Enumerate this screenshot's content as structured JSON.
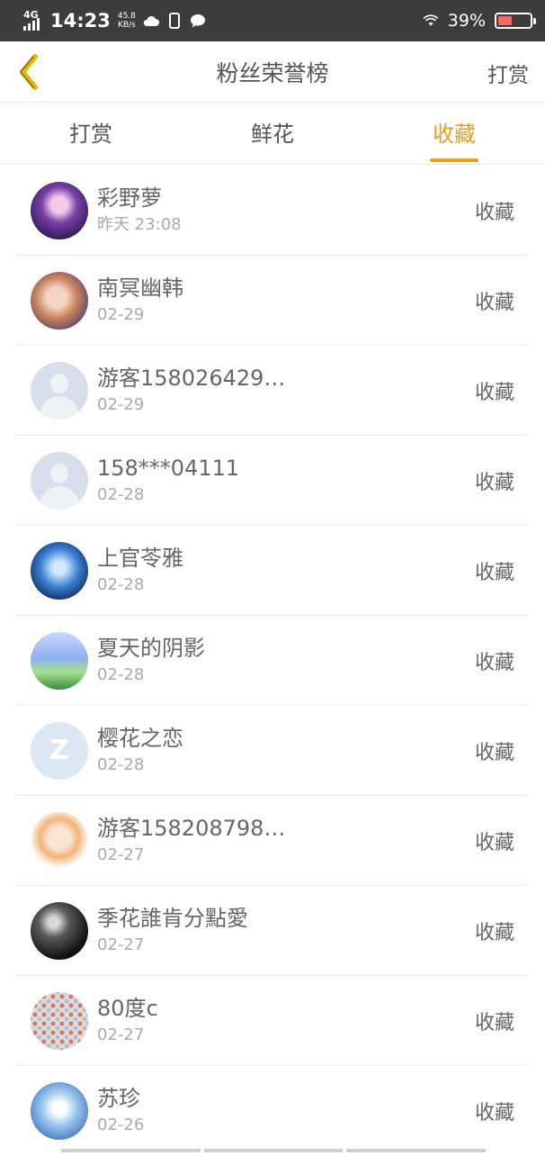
{
  "status_bar": {
    "network": "4G",
    "time": "14:23",
    "speed_value": "45.8",
    "speed_unit": "KB/s",
    "battery_pct": "39%",
    "battery_level": 0.39,
    "battery_color": "#f06a6a",
    "icons": [
      "cloud-icon",
      "phone-icon",
      "chat-bubble-icon",
      "wifi-icon",
      "battery-icon"
    ]
  },
  "header": {
    "title": "粉丝荣誉榜",
    "action": "打赏",
    "back_icon": "chevron-left-icon",
    "back_color": "#e6b800"
  },
  "tabs": [
    {
      "label": "打赏",
      "active": false
    },
    {
      "label": "鲜花",
      "active": false
    },
    {
      "label": "收藏",
      "active": true
    }
  ],
  "accent_color": "#e6a11c",
  "fans": [
    {
      "name": "彩野萝",
      "time": "昨天 23:08",
      "action": "收藏",
      "avatar": "anime-avatar"
    },
    {
      "name": "南冥幽韩",
      "time": "02-29",
      "action": "收藏",
      "avatar": "anime-avatar"
    },
    {
      "name": "游客158026429…",
      "time": "02-29",
      "action": "收藏",
      "avatar": "default-user-avatar"
    },
    {
      "name": "158***04111",
      "time": "02-28",
      "action": "收藏",
      "avatar": "default-user-avatar"
    },
    {
      "name": "上官苓雅",
      "time": "02-28",
      "action": "收藏",
      "avatar": "anime-avatar"
    },
    {
      "name": "夏天的阴影",
      "time": "02-28",
      "action": "收藏",
      "avatar": "landscape-avatar"
    },
    {
      "name": "樱花之恋",
      "time": "02-28",
      "action": "收藏",
      "avatar": "z-logo-avatar"
    },
    {
      "name": "游客158208798…",
      "time": "02-27",
      "action": "收藏",
      "avatar": "anime-avatar"
    },
    {
      "name": "季花誰肯分點愛",
      "time": "02-27",
      "action": "收藏",
      "avatar": "photo-avatar"
    },
    {
      "name": "80度c",
      "time": "02-27",
      "action": "收藏",
      "avatar": "pattern-avatar"
    },
    {
      "name": "苏珍",
      "time": "02-26",
      "action": "收藏",
      "avatar": "anime-avatar"
    }
  ]
}
